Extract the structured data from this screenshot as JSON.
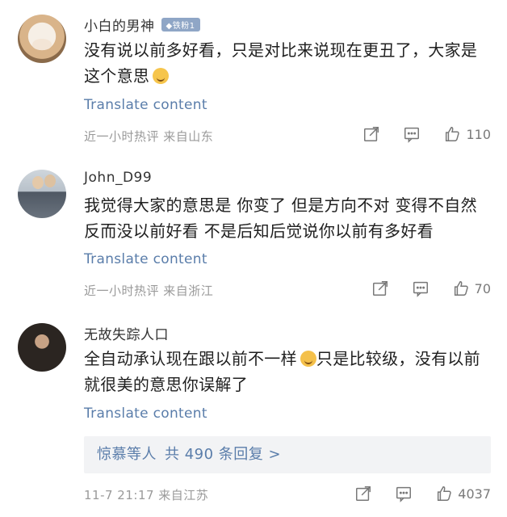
{
  "comments": [
    {
      "name": "小白的男神",
      "badge": "◆铁粉1",
      "text": "没有说以前多好看，只是对比来说现在更丑了，大家是这个意思",
      "translate": "Translate content",
      "meta": "近一小时热评  来自山东",
      "likes": "110"
    },
    {
      "name": "John_D99",
      "text": "我觉得大家的意思是 你变了 但是方向不对 变得不自然反而没以前好看 不是后知后觉说你以前有多好看",
      "translate": "Translate content",
      "meta": "近一小时热评  来自浙江",
      "likes": "70"
    },
    {
      "name": "无故失踪人口",
      "text_before": "全自动承认现在跟以前不一样",
      "text_after": "只是比较级，没有以前就很美的意思你误解了",
      "translate": "Translate content",
      "reply_people": "惊慕等人",
      "reply_count": "共 490 条回复 >",
      "meta": "11-7 21:17  来自江苏",
      "likes": "4037"
    }
  ],
  "colors": {
    "link": "#5a7daa",
    "meta": "#9a9a9a",
    "reply_bg": "#f2f3f5"
  }
}
